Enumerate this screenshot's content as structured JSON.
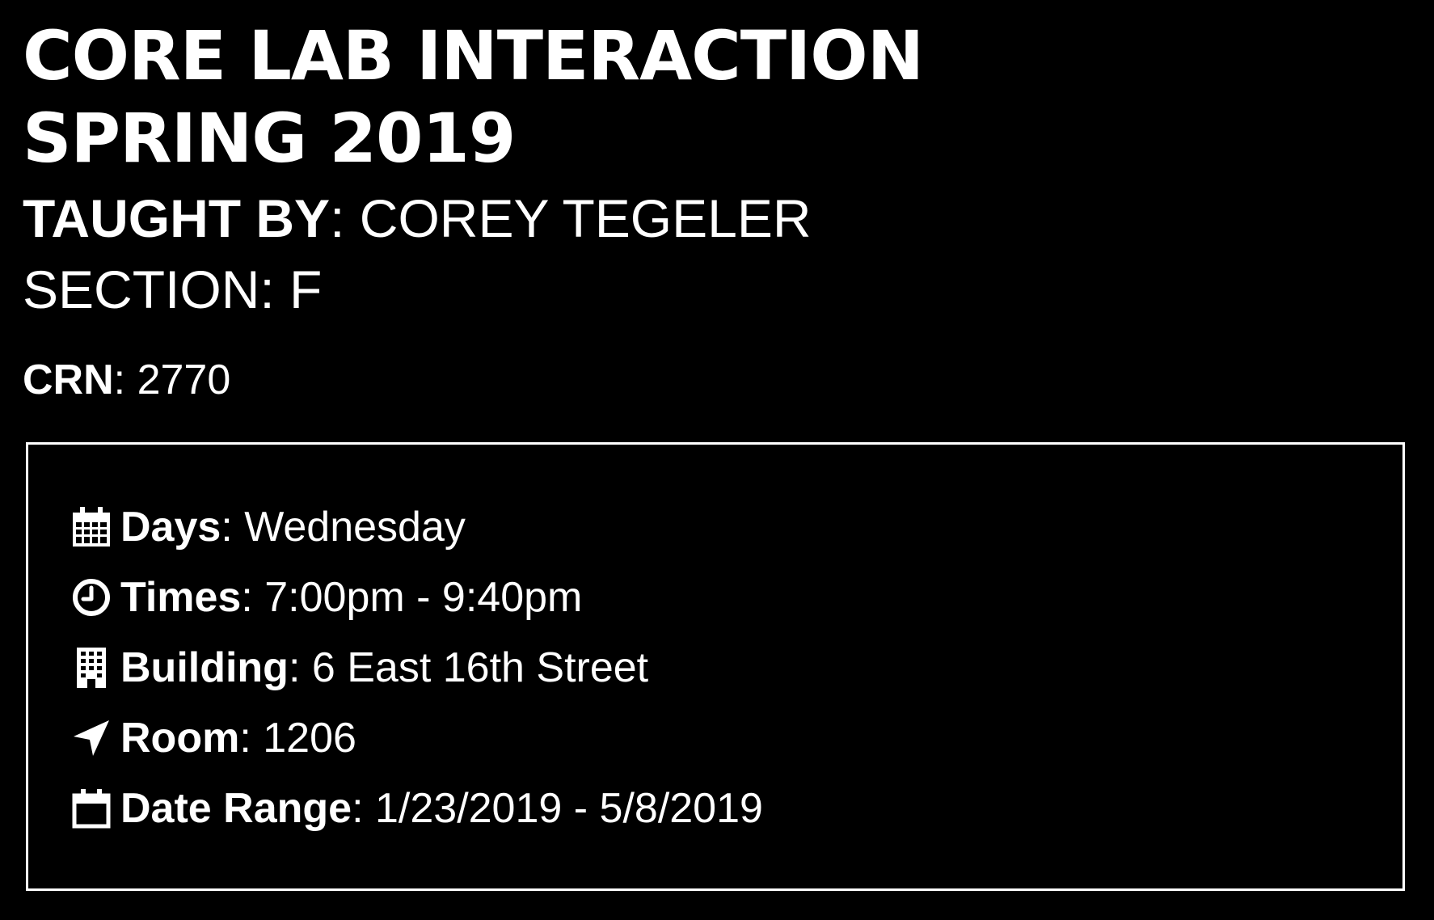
{
  "course": {
    "title_line1": "CORE LAB INTERACTION",
    "title_line2": "SPRING 2019",
    "taught_by_label": "TAUGHT BY",
    "instructor": "COREY TEGELER",
    "section_label": "SECTION:",
    "section": "F",
    "crn_label": "CRN",
    "crn": "2770"
  },
  "details": [
    {
      "icon": "calendar-grid-icon",
      "label": "Days",
      "value": "Wednesday"
    },
    {
      "icon": "clock-icon",
      "label": "Times",
      "value": "7:00pm - 9:40pm"
    },
    {
      "icon": "building-icon",
      "label": "Building",
      "value": "6 East 16th Street"
    },
    {
      "icon": "location-arrow-icon",
      "label": "Room",
      "value": "1206"
    },
    {
      "icon": "calendar-icon",
      "label": "Date Range",
      "value": "1/23/2019 - 5/8/2019"
    }
  ],
  "colors": {
    "background": "#000000",
    "text": "#ffffff",
    "border": "#ffffff"
  }
}
